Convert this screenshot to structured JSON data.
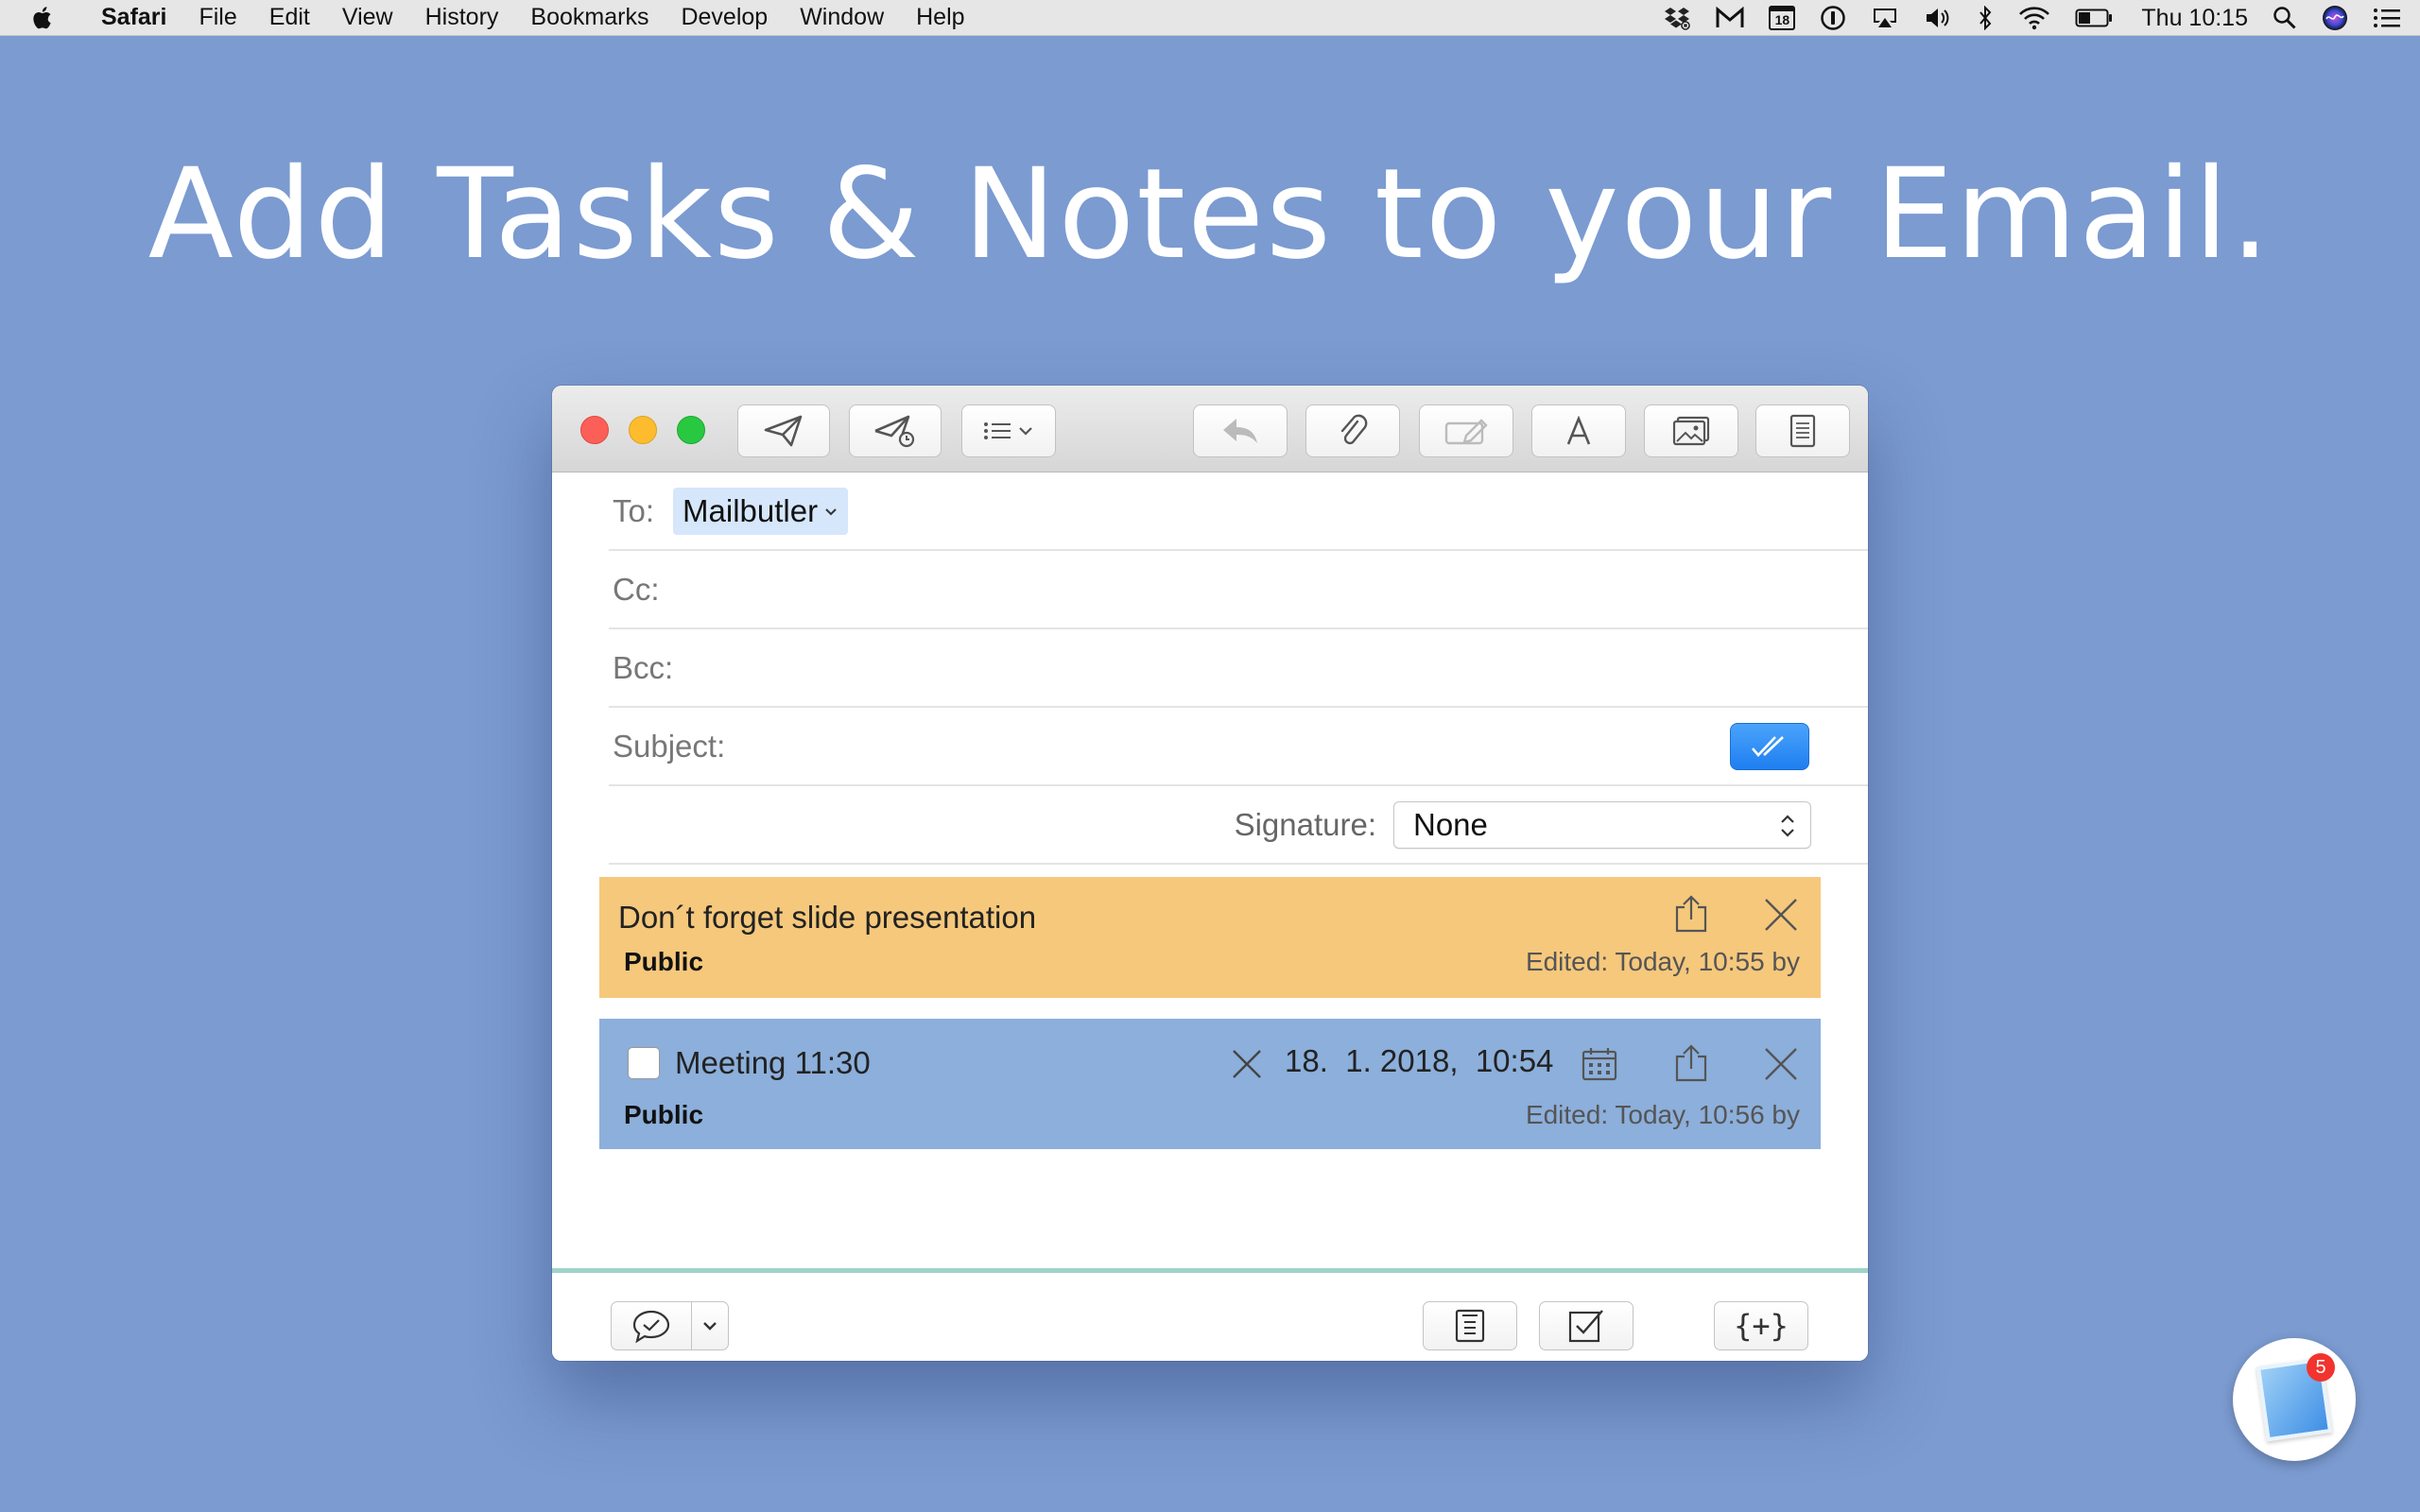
{
  "menubar": {
    "app_name": "Safari",
    "items": [
      "File",
      "Edit",
      "View",
      "History",
      "Bookmarks",
      "Develop",
      "Window",
      "Help"
    ],
    "calendar_day": "18",
    "clock": "Thu 10:15"
  },
  "headline": "Add Tasks & Notes to your Email.",
  "compose": {
    "to_label": "To:",
    "to_recipient": "Mailbutler",
    "cc_label": "Cc:",
    "bcc_label": "Bcc:",
    "subject_label": "Subject:",
    "signature_label": "Signature:",
    "signature_value": "None"
  },
  "notes": [
    {
      "title": "Don´t forget slide presentation",
      "visibility": "Public",
      "edited": "Edited: Today, 10:55 by",
      "color": "#f5c87c"
    }
  ],
  "tasks": [
    {
      "title": "Meeting 11:30",
      "due": "18.  1. 2018,  10:54",
      "visibility": "Public",
      "edited": "Edited: Today, 10:56 by",
      "color": "#8cafdb"
    }
  ],
  "bottom_bar": {
    "snippet_label": "{+}"
  },
  "dock": {
    "badge": "5"
  },
  "colors": {
    "background": "#7b9bd1",
    "accent_blue": "#1f7ef0",
    "divider": "#9fd3c9"
  }
}
